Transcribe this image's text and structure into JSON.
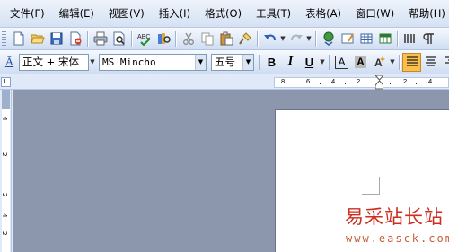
{
  "menu": [
    "文件(F)",
    "编辑(E)",
    "视图(V)",
    "插入(I)",
    "格式(O)",
    "工具(T)",
    "表格(A)",
    "窗口(W)",
    "帮助(H)"
  ],
  "toolbar_standard": [
    "new-document",
    "open",
    "save",
    "permission",
    "print",
    "print-preview",
    "spelling-grammar",
    "research",
    "cut",
    "copy",
    "paste",
    "format-painter",
    "undo",
    "redo",
    "hyperlink",
    "tables-borders",
    "insert-table",
    "insert-excel",
    "columns",
    "show-formatting"
  ],
  "formatting": {
    "style_icon": "Ā",
    "style": "正文 + 宋体",
    "font": "MS Mincho",
    "size": "五号",
    "bold": "B",
    "italic": "I",
    "underline": "U",
    "char_border": "A",
    "char_shading": "A"
  },
  "ruler": {
    "corner": "L",
    "h_numbers": [
      "8",
      "6",
      "4",
      "2",
      "2",
      "4"
    ],
    "v_numbers": [
      "4",
      "2",
      "2",
      "4",
      "2"
    ]
  },
  "watermark": {
    "text": "易采站长站",
    "url": "www.easck.com"
  },
  "colors": {
    "accent": "#fbbf4a",
    "watermark": "#cc2f22"
  }
}
